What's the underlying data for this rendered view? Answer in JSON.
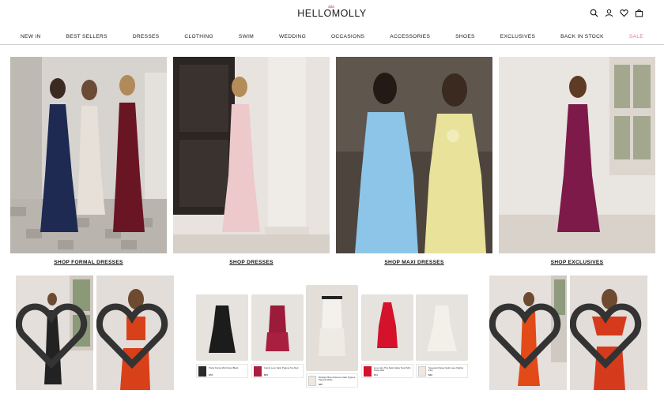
{
  "header": {
    "logo": "HELLOMOLLY",
    "icons": [
      "search-icon",
      "account-icon",
      "wishlist-icon",
      "bag-icon"
    ]
  },
  "nav": {
    "items": [
      "NEW IN",
      "BEST SELLERS",
      "DRESSES",
      "CLOTHING",
      "SWIM",
      "WEDDING",
      "OCCASIONS",
      "ACCESSORIES",
      "SHOES",
      "EXCLUSIVES",
      "BACK IN STOCK",
      "SALE"
    ],
    "sale_color": "#e6739a"
  },
  "hero": {
    "tiles": [
      {
        "label": "SHOP FORMAL DRESSES"
      },
      {
        "label": "SHOP DRESSES"
      },
      {
        "label": "SHOP MAXI DRESSES"
      },
      {
        "label": "SHOP EXCLUSIVES"
      }
    ]
  },
  "products": [
    {
      "name": "Pretty Fierce Mini Dress Black",
      "price": "$78"
    },
    {
      "name": "Candy Love Satin Pyjama Top Red",
      "price": "$55"
    },
    {
      "name": "Midnight Bloombstones Satin Pyjama Playsuit White",
      "price": "$65"
    },
    {
      "name": "Love Like This Satin Halter Neck Mini Dress Red",
      "price": "$72"
    },
    {
      "name": "Sweetest Kisses Satin Lace Nightie Pink",
      "price": "$60"
    }
  ],
  "product_add_symbol": "+"
}
